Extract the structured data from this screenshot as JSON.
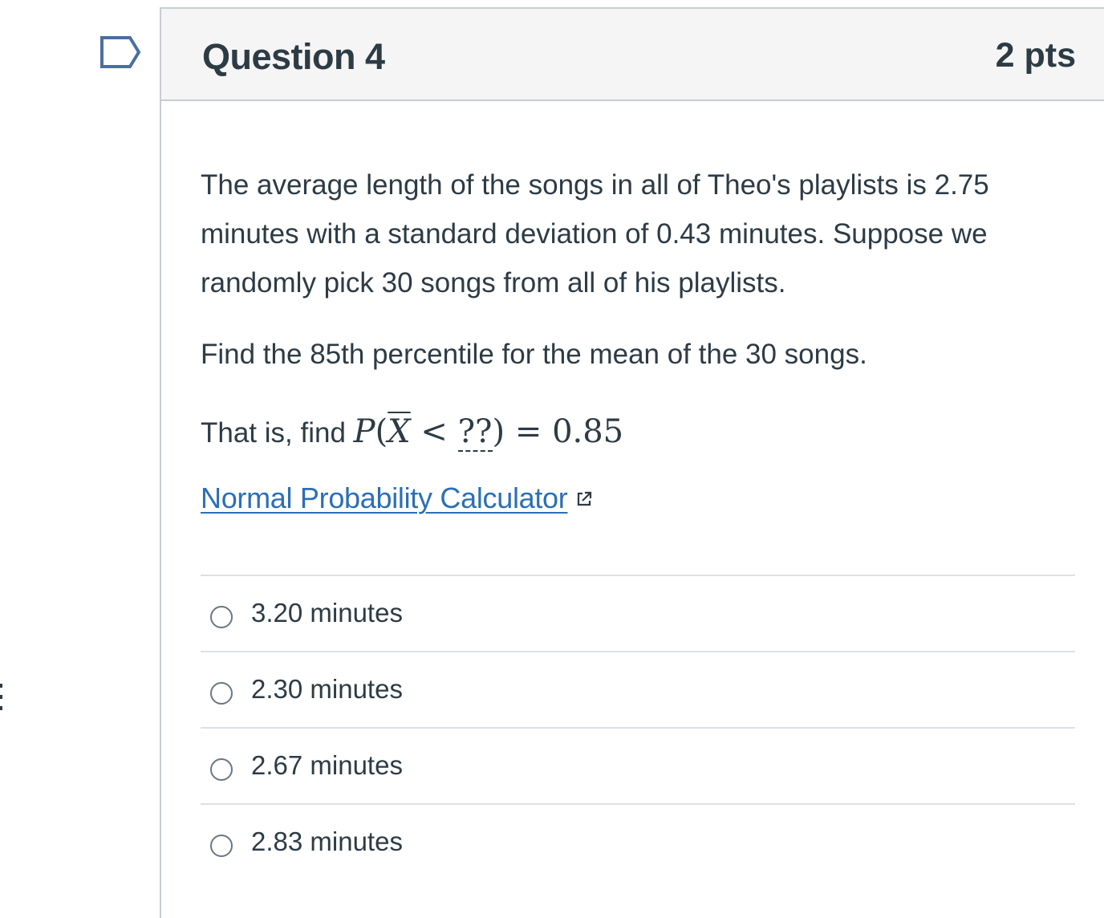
{
  "question": {
    "title": "Question 4",
    "points": "2 pts",
    "paragraph1": "The average length of the songs in all of Theo's playlists is 2.75 minutes with a standard deviation of 0.43 minutes. Suppose we randomly pick 30 songs from all of his playlists.",
    "paragraph2": "Find the 85th percentile for the mean of the 30 songs.",
    "formula_prefix": "That is, find ",
    "formula": {
      "p": "P",
      "open": "(",
      "xbar": "X",
      "lt": " < ",
      "unknown": "??",
      "close": ")",
      "eq": " = ",
      "value": "0.85"
    },
    "calculator_link": "Normal Probability Calculator"
  },
  "answers": [
    {
      "label": "3.20 minutes",
      "selected": false
    },
    {
      "label": "2.30 minutes",
      "selected": false
    },
    {
      "label": "2.67 minutes",
      "selected": false
    },
    {
      "label": "2.83 minutes",
      "selected": false
    }
  ],
  "icons": {
    "flag": "flag-question-icon",
    "external_link": "external-link-icon"
  },
  "colors": {
    "text": "#2d3b45",
    "link": "#2b6fb6",
    "header_bg": "#f5f5f5",
    "border": "#c7cdd1",
    "flag": "#4a6fa0"
  }
}
